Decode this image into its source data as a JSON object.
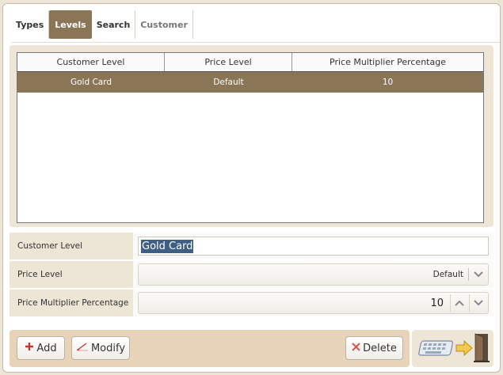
{
  "tabs": [
    {
      "label": "Types"
    },
    {
      "label": "Levels"
    },
    {
      "label": "Search"
    },
    {
      "label": "Customer"
    }
  ],
  "grid": {
    "columns": [
      "Customer Level",
      "Price Level",
      "Price Multiplier Percentage"
    ],
    "rows": [
      {
        "customer_level": "Gold Card",
        "price_level": "Default",
        "multiplier": "10"
      }
    ]
  },
  "form": {
    "customer_level_label": "Customer Level",
    "customer_level_value": "Gold Card",
    "price_level_label": "Price Level",
    "price_level_value": "Default",
    "multiplier_label": "Price Multiplier Percentage",
    "multiplier_value": "10"
  },
  "toolbar": {
    "add_label": "Add",
    "modify_label": "Modify",
    "delete_label": "Delete"
  },
  "icons": {
    "add": "plus-icon",
    "modify": "pencil-icon",
    "delete": "x-icon",
    "exit": "keyboard-exit-icon"
  },
  "colors": {
    "accent": "#8a7657",
    "panel": "#ede5d6",
    "toolbar": "#e6d3b8",
    "add_icon": "#c0392b",
    "delete_icon": "#d9534f"
  }
}
